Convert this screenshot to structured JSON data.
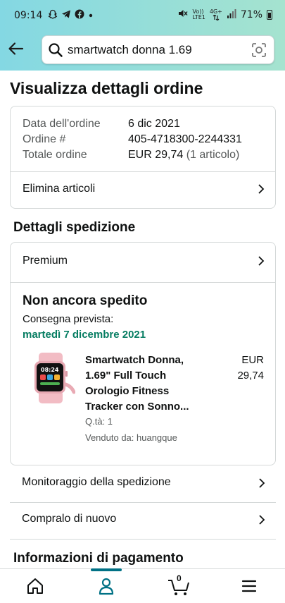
{
  "status_bar": {
    "time": "09:14",
    "network_top": "Vo))",
    "network_bottom": "LTE1",
    "data_top": "4G+",
    "battery": "71%"
  },
  "search": {
    "value": "smartwatch donna 1.69",
    "icons": [
      "back-arrow-icon",
      "search-icon",
      "camera-scan-icon"
    ]
  },
  "page_title": "Visualizza dettagli ordine",
  "order_info": {
    "date_label": "Data dell'ordine",
    "date_value": "6 dic 2021",
    "number_label": "Ordine #",
    "number_value": "405-4718300-2244331",
    "total_label": "Totale ordine",
    "total_value": "EUR 29,74",
    "total_items": "(1 articolo)",
    "delete_label": "Elimina articoli"
  },
  "shipping": {
    "section_title": "Dettagli spedizione",
    "shipping_speed": "Premium",
    "status": "Non ancora spedito",
    "delivery_label": "Consegna prevista:",
    "delivery_date": "martedì 7 dicembre 2021",
    "delivery_color": "#067d62",
    "product": {
      "name": "Smartwatch Donna, 1.69\" Full Touch Orologio Fitness Tracker con Sonno...",
      "price_currency": "EUR",
      "price_amount": "29,74",
      "quantity": "Q.tà: 1",
      "seller": "Venduto da: huangque",
      "watch_time": "08:24"
    }
  },
  "actions": {
    "track": "Monitoraggio della spedizione",
    "buy_again": "Compralo di nuovo"
  },
  "payment": {
    "section_title": "Informazioni di pagamento"
  },
  "bottom_nav": {
    "items": [
      "home-icon",
      "account-icon",
      "cart-icon",
      "menu-icon"
    ],
    "active": "account-icon",
    "cart_count": "0",
    "accent": "#007185"
  }
}
